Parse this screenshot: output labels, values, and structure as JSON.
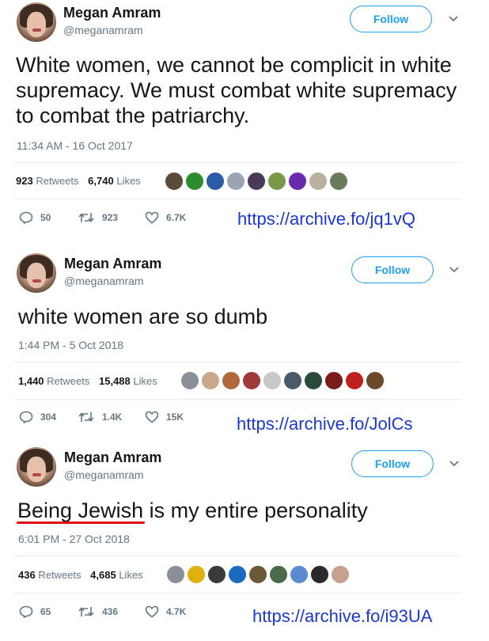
{
  "tweets": [
    {
      "name": "Megan Amram",
      "handle": "@meganamram",
      "follow_label": "Follow",
      "text": "White women, we cannot be complicit in white supremacy. We must combat white supremacy to combat the patriarchy.",
      "timestamp": "11:34 AM - 16 Oct 2017",
      "retweets": "923",
      "retweets_label": "Retweets",
      "likes": "6,740",
      "likes_label": "Likes",
      "replies_count": "50",
      "retweet_count": "923",
      "like_count": "6.7K",
      "archive_link": "https://archive.fo/jq1vQ",
      "liker_colors": [
        "#5a4a3a",
        "#2e8b2e",
        "#2a5aa8",
        "#9aa5b1",
        "#4a3a5a",
        "#7a9a4a",
        "#6a2ab0",
        "#b9b0a0",
        "#6a7a5a"
      ]
    },
    {
      "name": "Megan Amram",
      "handle": "@meganamram",
      "follow_label": "Follow",
      "text": "white women are so dumb",
      "timestamp": "1:44 PM - 5 Oct 2018",
      "retweets": "1,440",
      "retweets_label": "Retweets",
      "likes": "15,488",
      "likes_label": "Likes",
      "replies_count": "304",
      "retweet_count": "1.4K",
      "like_count": "15K",
      "archive_link": "https://archive.fo/JolCs",
      "liker_colors": [
        "#8a8f98",
        "#c9a88a",
        "#b0683a",
        "#a03a3a",
        "#c8c8c8",
        "#4a5a6a",
        "#2a4a3a",
        "#7a1a1a",
        "#c02020",
        "#6a4a2a"
      ]
    },
    {
      "name": "Megan Amram",
      "handle": "@meganamram",
      "follow_label": "Follow",
      "text": "Being Jewish is my entire personality",
      "timestamp": "6:01 PM - 27 Oct 2018",
      "retweets": "436",
      "retweets_label": "Retweets",
      "likes": "4,685",
      "likes_label": "Likes",
      "replies_count": "65",
      "retweet_count": "436",
      "like_count": "4.7K",
      "archive_link": "https://archive.fo/i93UA",
      "liker_colors": [
        "#8a8f98",
        "#e0b010",
        "#3a3a3a",
        "#1a6ac0",
        "#6a5a3a",
        "#4a6a4a",
        "#5a8ad0",
        "#2a2a2a",
        "#c8a090"
      ]
    }
  ],
  "colors": {
    "accent": "#1da1f2",
    "archive_link": "#1a37d8",
    "underline": "#e0101a",
    "secondary_text": "#657786"
  },
  "icons": {
    "reply": "reply-icon",
    "retweet": "retweet-icon",
    "like": "heart-icon",
    "more": "chevron-down-icon"
  }
}
